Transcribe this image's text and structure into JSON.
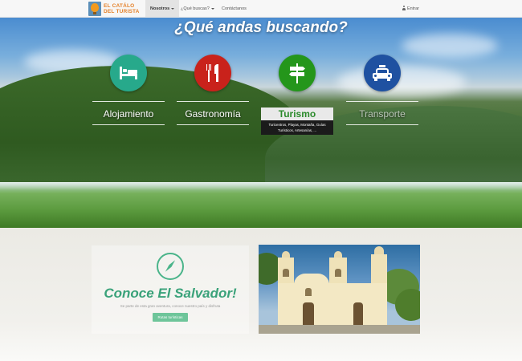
{
  "brand": {
    "logo_line1": "EL CATÁLO",
    "logo_line2": "DEL TURISTA",
    "logo_color": "#e4812a"
  },
  "nav": {
    "items": [
      {
        "label": "Nosotros",
        "has_caret": true,
        "active": true
      },
      {
        "label": "¿Qué buscas?",
        "has_caret": true,
        "active": false
      },
      {
        "label": "Contáctanos",
        "has_caret": false,
        "active": false
      }
    ],
    "login_label": "Entrar",
    "login_icon": "user-icon"
  },
  "hero": {
    "title": "¿Qué andas buscando?",
    "categories": [
      {
        "label": "Alojamiento",
        "icon": "bed-icon",
        "color": "#27a98b"
      },
      {
        "label": "Gastronomía",
        "icon": "cutlery-icon",
        "color": "#c9221b"
      },
      {
        "label": "Turismo",
        "icon": "signpost-icon",
        "color": "#24961b",
        "description": "Turicentros, Playas, Montaña, Guías Turísticos, Artesanías, ..."
      },
      {
        "label": "Transporte",
        "icon": "taxi-icon",
        "color": "#1f51a1"
      }
    ]
  },
  "promo": {
    "icon": "compass-icon",
    "title": "Conoce El Salvador!",
    "text": "Se parte de esta gran aventura, conoce nuestro país y disfruta",
    "button_label": "Rutas turísticas",
    "accent": "#3aa27a"
  },
  "photo": {
    "subject": "church"
  }
}
